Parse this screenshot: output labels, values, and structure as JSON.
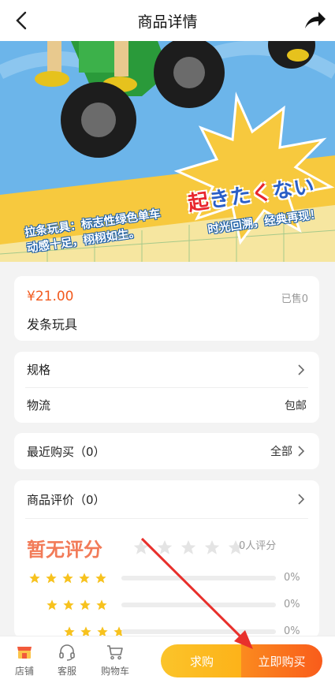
{
  "header": {
    "title": "商品详情",
    "back_icon": "chevron-left-icon",
    "share_icon": "share-arrow-icon"
  },
  "banner": {
    "jp_text": [
      "起",
      "き",
      "た",
      "く",
      "な",
      "い"
    ],
    "jp_colors": [
      "#e8262d",
      "#2a5fc7",
      "#2a5fc7",
      "#e8262d",
      "#2a5fc7",
      "#2a5fc7"
    ],
    "caption_left_line1": "拉条玩具：标志性绿色单车",
    "caption_left_line2": "动感十足，栩栩如生。",
    "caption_right": "时光回溯，经典再现！",
    "slide_count": 5,
    "active_slide": 1
  },
  "product": {
    "price": "¥21.00",
    "sold": "已售0",
    "name": "发条玩具"
  },
  "spec": {
    "spec_label": "规格",
    "shipping_label": "物流",
    "shipping_value": "包邮"
  },
  "recent": {
    "label": "最近购买（0）",
    "all_label": "全部"
  },
  "reviews": {
    "title": "商品评价（0）",
    "no_score": "暂无评分",
    "rating_count": "0人评分",
    "breakdown": [
      {
        "stars": 5,
        "percent": "0%"
      },
      {
        "stars": 4,
        "percent": "0%"
      },
      {
        "stars": 3,
        "percent": "0%"
      }
    ]
  },
  "tabbar": {
    "shop_label": "店铺",
    "service_label": "客服",
    "cart_label": "购物车",
    "ask_label": "求购",
    "buy_label": "立即购买"
  },
  "colors": {
    "accent": "#f25a1e",
    "star": "#f7c21e",
    "ask_button": "#fdb219",
    "buy_button": "#f95c1b",
    "annotation_arrow": "#e8302c"
  }
}
